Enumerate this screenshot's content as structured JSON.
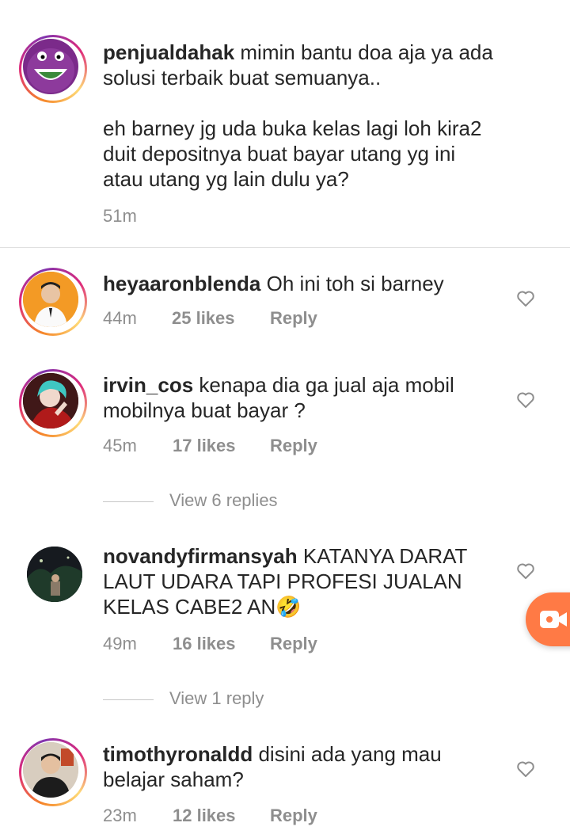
{
  "comments": [
    {
      "username": "penjualdahak",
      "text": "mimin bantu doa aja ya ada\nsolusi terbaik buat semuanya..\n\neh barney jg uda buka kelas lagi loh kira2\nduit depositnya buat bayar utang yg ini\natau utang yg lain dulu ya?",
      "time": "51m",
      "avatar_icon": "barney-avatar-icon"
    },
    {
      "username": "heyaaronblenda",
      "text": "Oh ini toh si barney",
      "time": "44m",
      "likes": "25 likes",
      "reply": "Reply",
      "avatar_icon": "man-portrait-avatar-icon"
    },
    {
      "username": "irvin_cos",
      "text": "kenapa dia ga jual aja mobil\nmobilnya buat bayar ?",
      "time": "45m",
      "likes": "17 likes",
      "reply": "Reply",
      "view_replies": "View 6 replies",
      "avatar_icon": "cosplay-avatar-icon"
    },
    {
      "username": "novandyfirmansyah",
      "text": "KATANYA DARAT\nLAUT UDARA TAPI PROFESI JUALAN\nKELAS CABE2 AN🤣",
      "time": "49m",
      "likes": "16 likes",
      "reply": "Reply",
      "view_replies": "View 1 reply",
      "avatar_icon": "night-scene-avatar-icon"
    },
    {
      "username": "timothyronaldd",
      "text": "disini ada yang mau\nbelajar saham?",
      "time": "23m",
      "likes": "12 likes",
      "reply": "Reply",
      "avatar_icon": "man-suit-avatar-icon"
    }
  ],
  "colors": {
    "text": "#262626",
    "muted": "#8e8e8e",
    "story_ring_start": "#f58529",
    "story_ring_end": "#dd2a7b",
    "record_button": "#ff7a45"
  },
  "floating_button_icon": "video-record-icon"
}
